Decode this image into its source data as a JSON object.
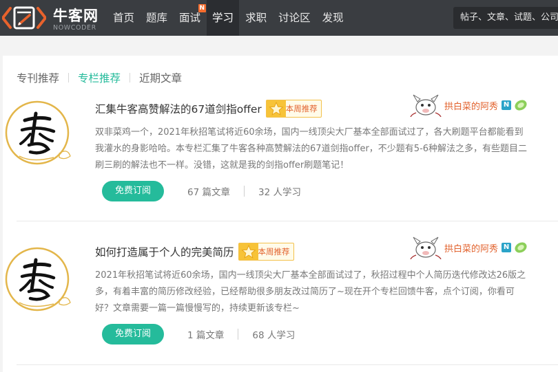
{
  "header": {
    "logo_title": "牛客网",
    "logo_subtitle": "NOWCODER",
    "nav": [
      {
        "label": "首页",
        "name": "nav-home"
      },
      {
        "label": "题库",
        "name": "nav-question-bank"
      },
      {
        "label": "面试",
        "name": "nav-interview",
        "badge": "N"
      },
      {
        "label": "学习",
        "name": "nav-learn",
        "active": true
      },
      {
        "label": "求职",
        "name": "nav-jobs"
      },
      {
        "label": "讨论区",
        "name": "nav-discuss"
      },
      {
        "label": "发现",
        "name": "nav-discover"
      }
    ],
    "search_placeholder": "帖子、文章、试题、公司"
  },
  "tabs": [
    {
      "label": "专刊推荐"
    },
    {
      "label": "专栏推荐",
      "active": true
    },
    {
      "label": "近期文章"
    }
  ],
  "columns": [
    {
      "title": "汇集牛客高赞解法的67道剑指offer",
      "badge": "本周推荐",
      "author": "拱白菜的阿秀",
      "author_level": "N",
      "description": "双非菜鸡一个，2021年秋招笔试将近60余场，国内一线顶尖大厂基本全部面试过了，各大刷题平台都能看到我灌水的身影哈哈。本专栏汇集了牛客各种高赞解法的67道剑指offer，不少题有5-6种解法之多，有些题目二刷三刷的解法也不一样。没错，这就是我的剑指offer刷题笔记！",
      "subscribe_label": "免费订阅",
      "articles": "67 篇文章",
      "learners": "32 人学习"
    },
    {
      "title": "如何打造属于个人的完美简历",
      "badge": "本周推荐",
      "author": "拱白菜的阿秀",
      "author_level": "N",
      "description": "2021年秋招笔试将近60余场，国内一线顶尖大厂基本全部面试过了，秋招过程中个人简历迭代修改达26版之多，有着丰富的简历修改经验，已经帮助很多朋友改过简历了~现在开个专栏回馈牛客，点个订阅，你看可好？文章需要一篇一篇慢慢写的，持续更新该专栏~",
      "subscribe_label": "免费订阅",
      "articles": "1 篇文章",
      "learners": "68 人学习"
    }
  ],
  "colors": {
    "accent": "#25bb9b",
    "topbar": "#3a3d41",
    "author_name": "#e2622d",
    "badge_border": "#f3c14a"
  }
}
